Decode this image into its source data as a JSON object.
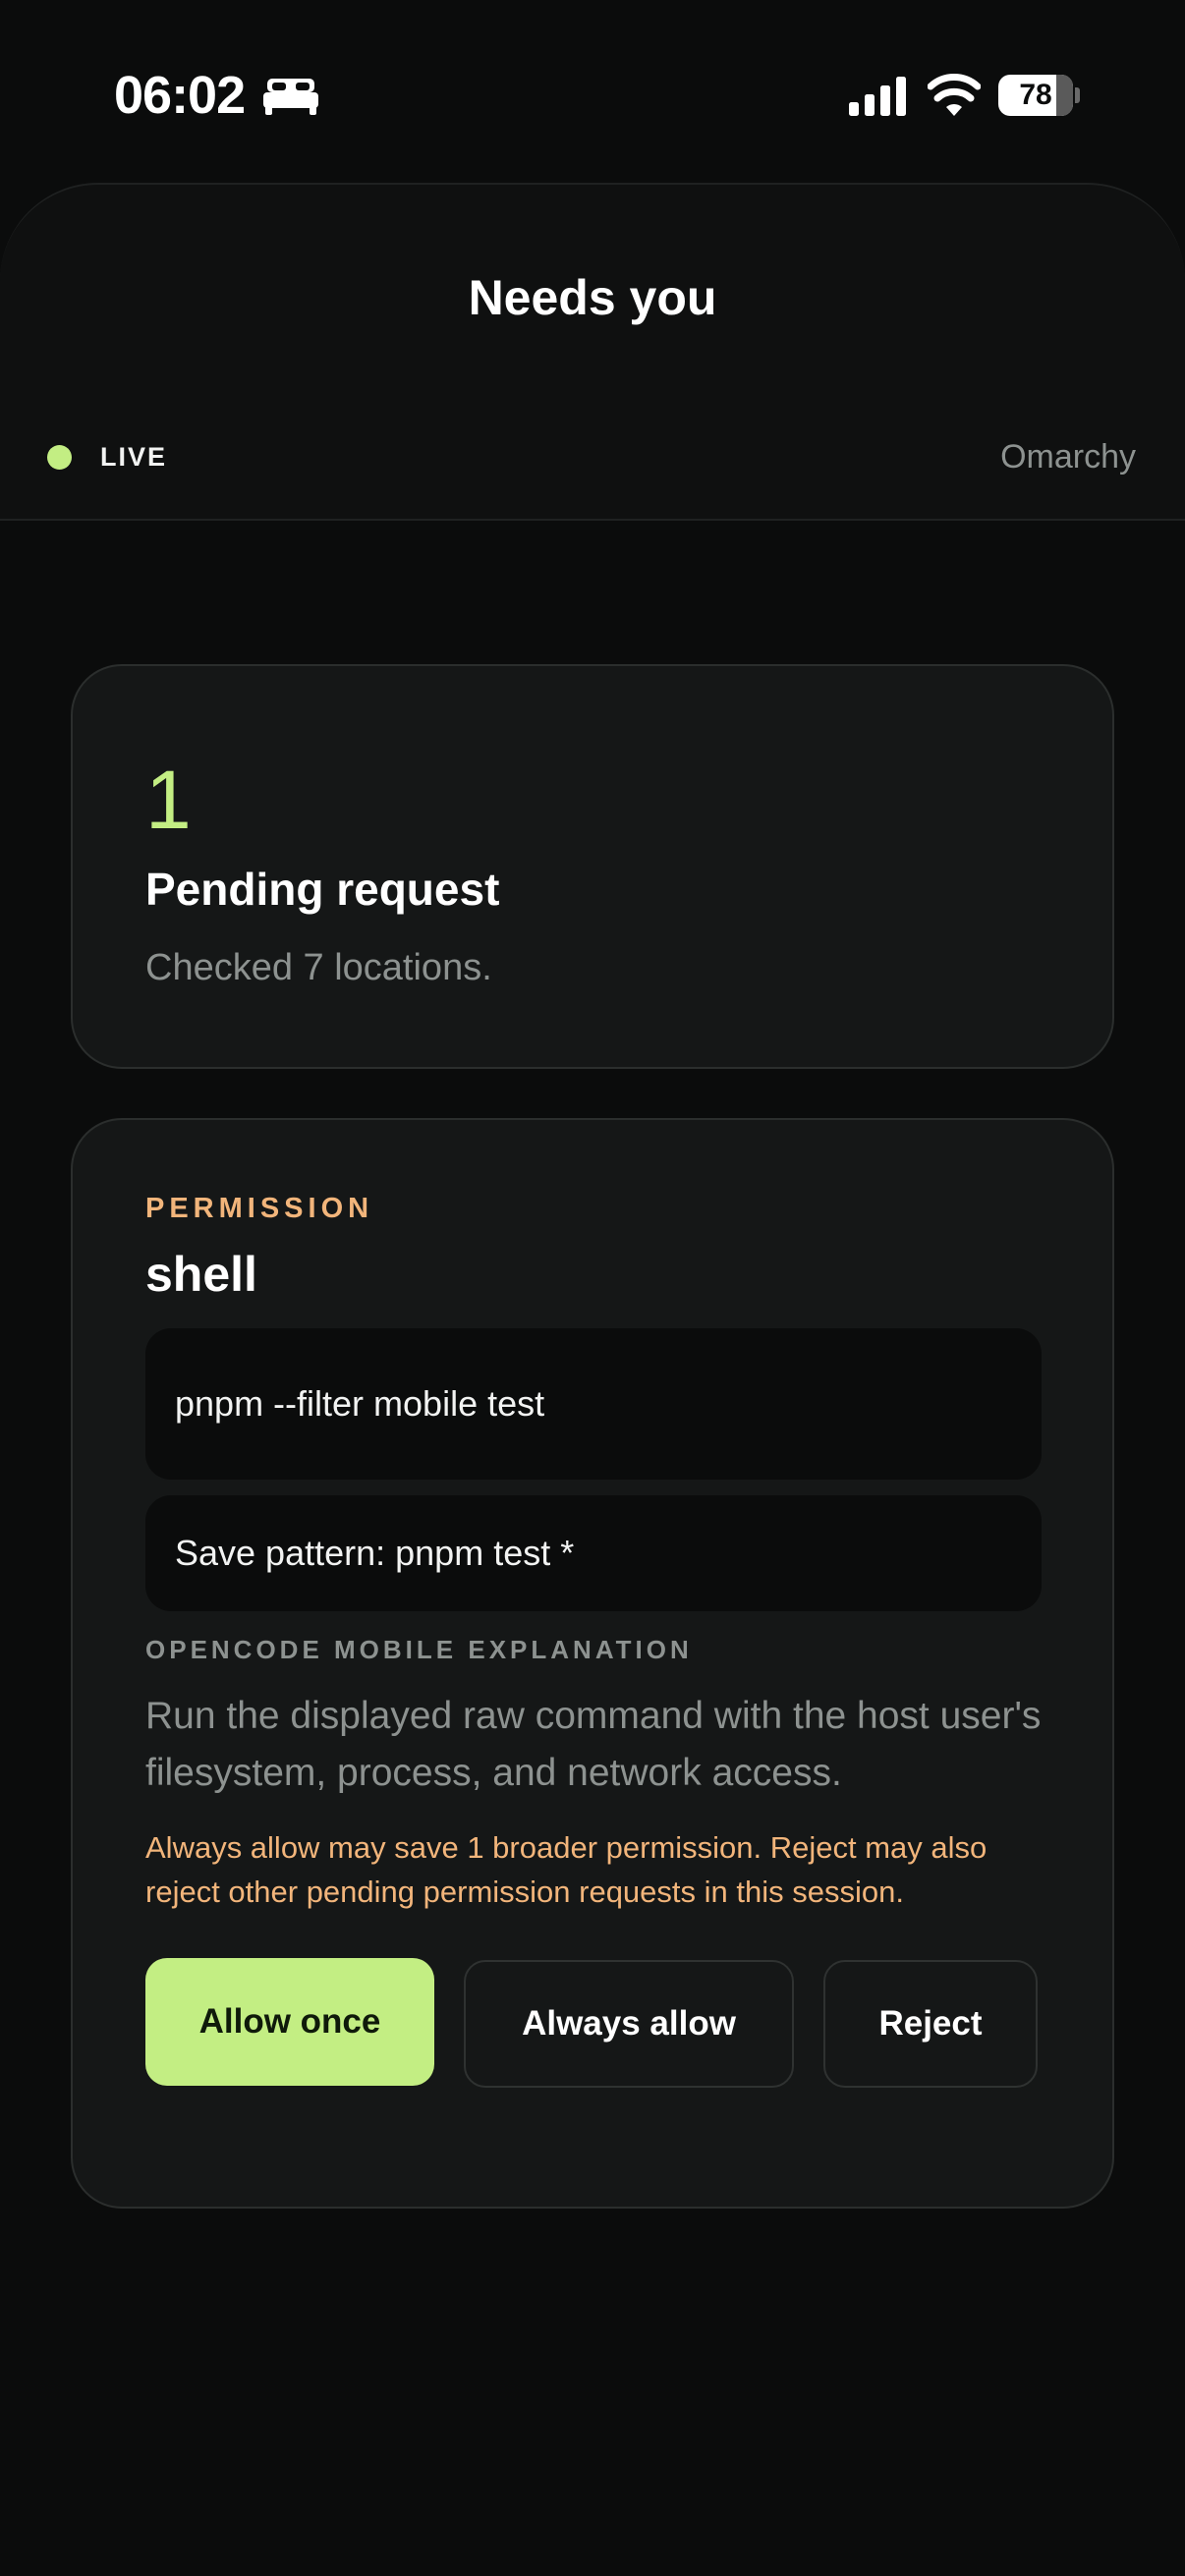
{
  "status_bar": {
    "time": "06:02",
    "battery_level": "78",
    "battery_fraction": 0.78,
    "icons": [
      "bed-icon",
      "cellular-signal-icon",
      "wifi-icon",
      "battery-icon"
    ]
  },
  "header": {
    "title": "Needs you",
    "live_label": "LIVE",
    "host": "Omarchy"
  },
  "summary": {
    "count": "1",
    "title": "Pending request",
    "subtitle": "Checked 7 locations."
  },
  "permission": {
    "eyebrow": "PERMISSION",
    "tool": "shell",
    "command": "pnpm --filter mobile test",
    "save_pattern": "Save pattern: pnpm test *",
    "explanation_label": "OPENCODE MOBILE EXPLANATION",
    "explanation": "Run the displayed raw command with the host user's filesystem, process, and network access.",
    "warning": "Always allow may save 1 broader permission. Reject may also reject other pending permission requests in this session.",
    "actions": {
      "allow_once": "Allow once",
      "always_allow": "Always allow",
      "reject": "Reject"
    }
  },
  "colors": {
    "background": "#0b0c0c",
    "card": "#151717",
    "accent_green": "#c3ee83",
    "accent_orange": "#f2b57b",
    "muted_text": "#8d9290"
  }
}
